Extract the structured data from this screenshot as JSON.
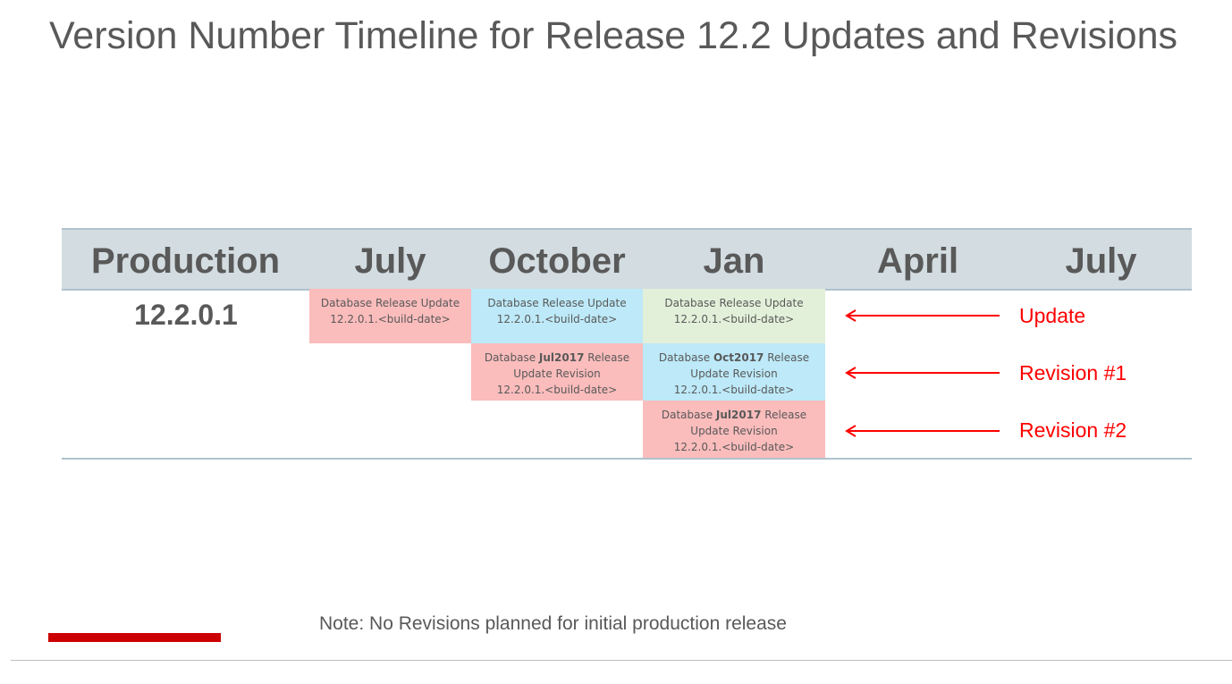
{
  "title": "Version Number Timeline for Release 12.2 Updates and Revisions",
  "header": [
    "Production",
    "July",
    "October",
    "Jan",
    "April",
    "July"
  ],
  "production_version": "12.2.0.1",
  "cells": [
    {
      "line1_pre": "Database Release Update",
      "bold": "",
      "line1_post": "",
      "line2": "",
      "line3": "12.2.0.1.<build-date>",
      "color": "#fbbcbc"
    },
    {
      "line1_pre": "Database Release Update",
      "bold": "",
      "line1_post": "",
      "line2": "",
      "line3": "12.2.0.1.<build-date>",
      "color": "#bde9f8"
    },
    {
      "line1_pre": "Database Release Update",
      "bold": "",
      "line1_post": "",
      "line2": "",
      "line3": "12.2.0.1.<build-date>",
      "color": "#e2f0d9"
    },
    {
      "line1_pre": "Database ",
      "bold": "Jul2017",
      "line1_post": " Release",
      "line2": "Update Revision",
      "line3": "12.2.0.1.<build-date>",
      "color": "#fbbcbc"
    },
    {
      "line1_pre": "Database ",
      "bold": "Oct2017",
      "line1_post": " Release",
      "line2": "Update Revision",
      "line3": "12.2.0.1.<build-date>",
      "color": "#bde9f8"
    },
    {
      "line1_pre": "Database ",
      "bold": "Jul2017",
      "line1_post": " Release",
      "line2": "Update Revision",
      "line3": "12.2.0.1.<build-date>",
      "color": "#fbbcbc"
    }
  ],
  "annotations": [
    "Update",
    "Revision #1",
    "Revision #2"
  ],
  "note": "Note:  No Revisions planned for initial production release",
  "colors": {
    "accent": "#cc0000",
    "annotation": "#ff0000",
    "header_bg": "#d3dce0"
  }
}
